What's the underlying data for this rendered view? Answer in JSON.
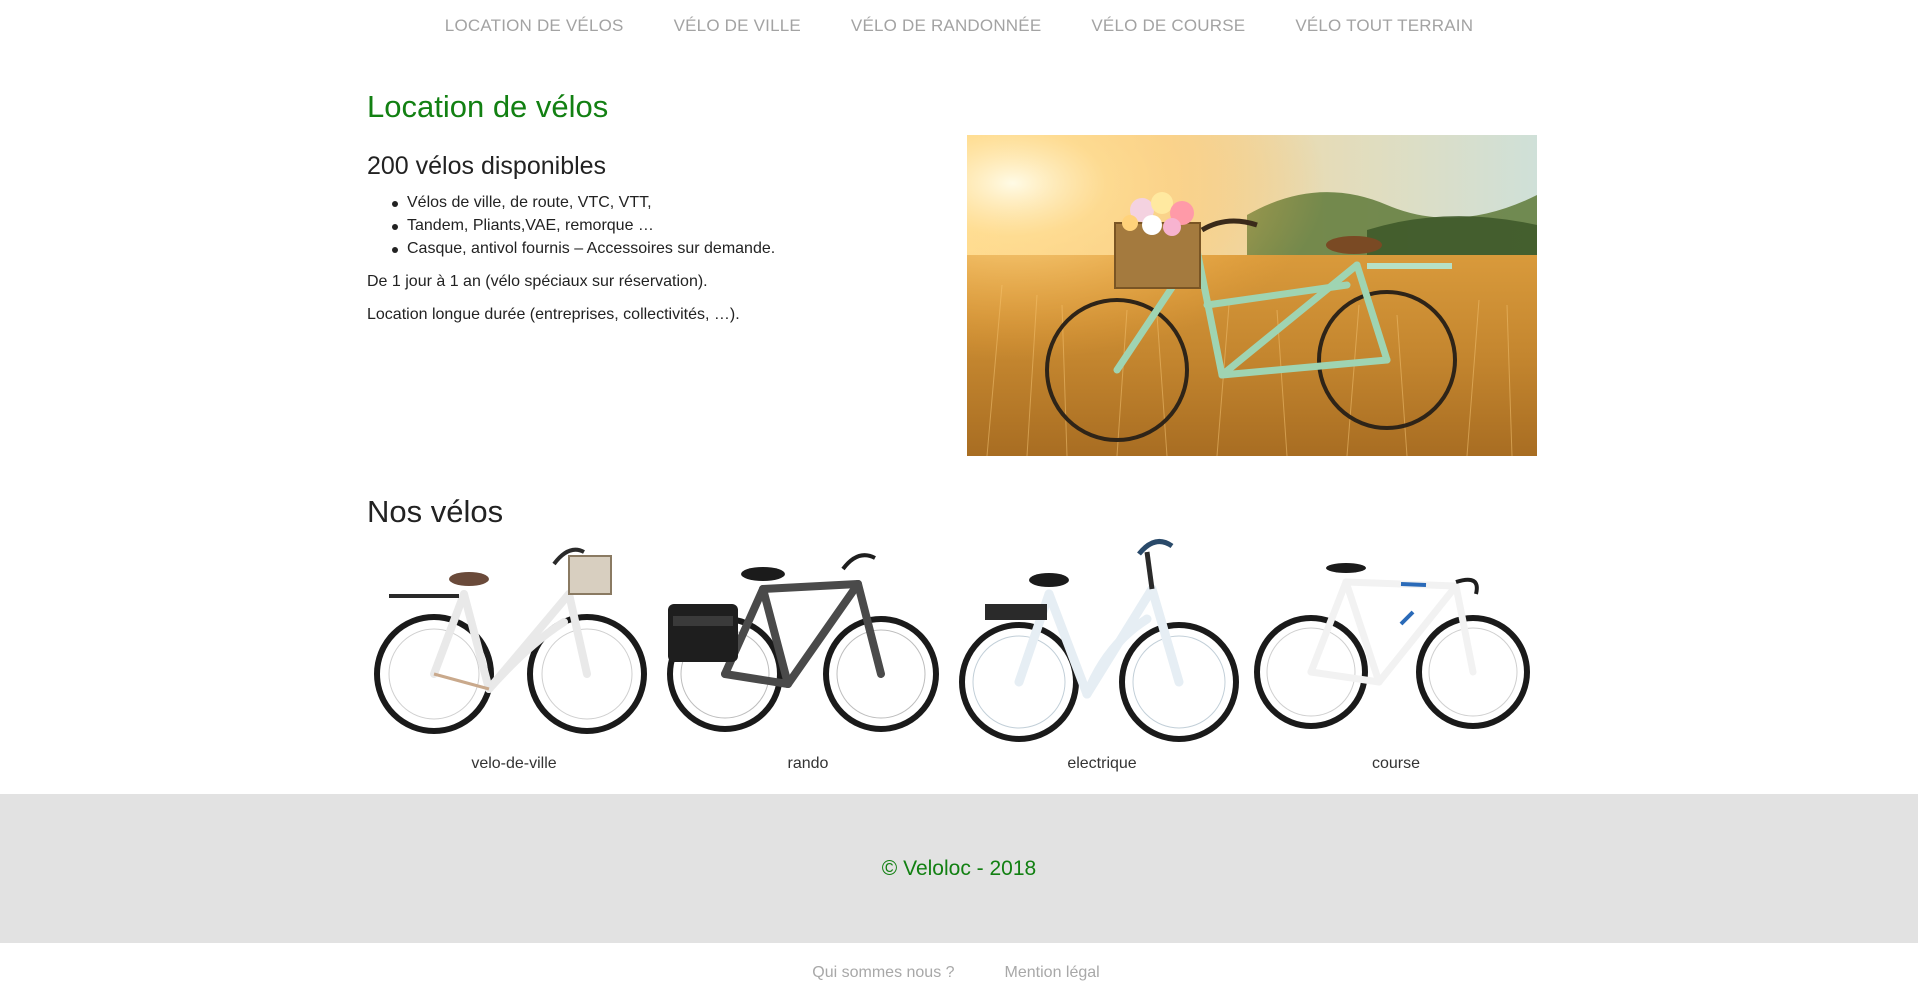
{
  "nav": {
    "items": [
      {
        "label": "LOCATION DE VÉLOS"
      },
      {
        "label": "VÉLO DE VILLE"
      },
      {
        "label": "VÉLO DE RANDONNÉE"
      },
      {
        "label": "VÉLO DE COURSE"
      },
      {
        "label": "VÉLO TOUT TERRAIN"
      }
    ]
  },
  "main": {
    "title": "Location de vélos",
    "subtitle": "200 vélos disponibles",
    "bullets": [
      "Vélos de ville, de route, VTC, VTT,",
      "Tandem, Pliants,VAE, remorque …",
      "Casque, antivol fournis – Accessoires sur demande."
    ],
    "paragraphs": [
      "De 1 jour à 1 an (vélo spéciaux sur réservation).",
      "Location longue durée (entreprises, collectivités, …)."
    ]
  },
  "bikes": {
    "title": "Nos vélos",
    "items": [
      {
        "label": "velo-de-ville",
        "frame_color": "#ececec",
        "accent": "#c9a98c"
      },
      {
        "label": "rando",
        "frame_color": "#4a4a4a",
        "accent": "#1e1e1e"
      },
      {
        "label": "electrique",
        "frame_color": "#e6eef4",
        "accent": "#2a2a2a"
      },
      {
        "label": "course",
        "frame_color": "#f2f2f2",
        "accent": "#2a6ab8"
      }
    ]
  },
  "footer": {
    "copyright": "© Veloloc - 2018"
  },
  "bottom_nav": {
    "items": [
      {
        "label": "Qui sommes nous ?"
      },
      {
        "label": "Mention légal"
      }
    ]
  },
  "colors": {
    "brand_green": "#128012",
    "nav_grey": "#a3a3a3",
    "footer_bg": "#e2e2e2"
  }
}
